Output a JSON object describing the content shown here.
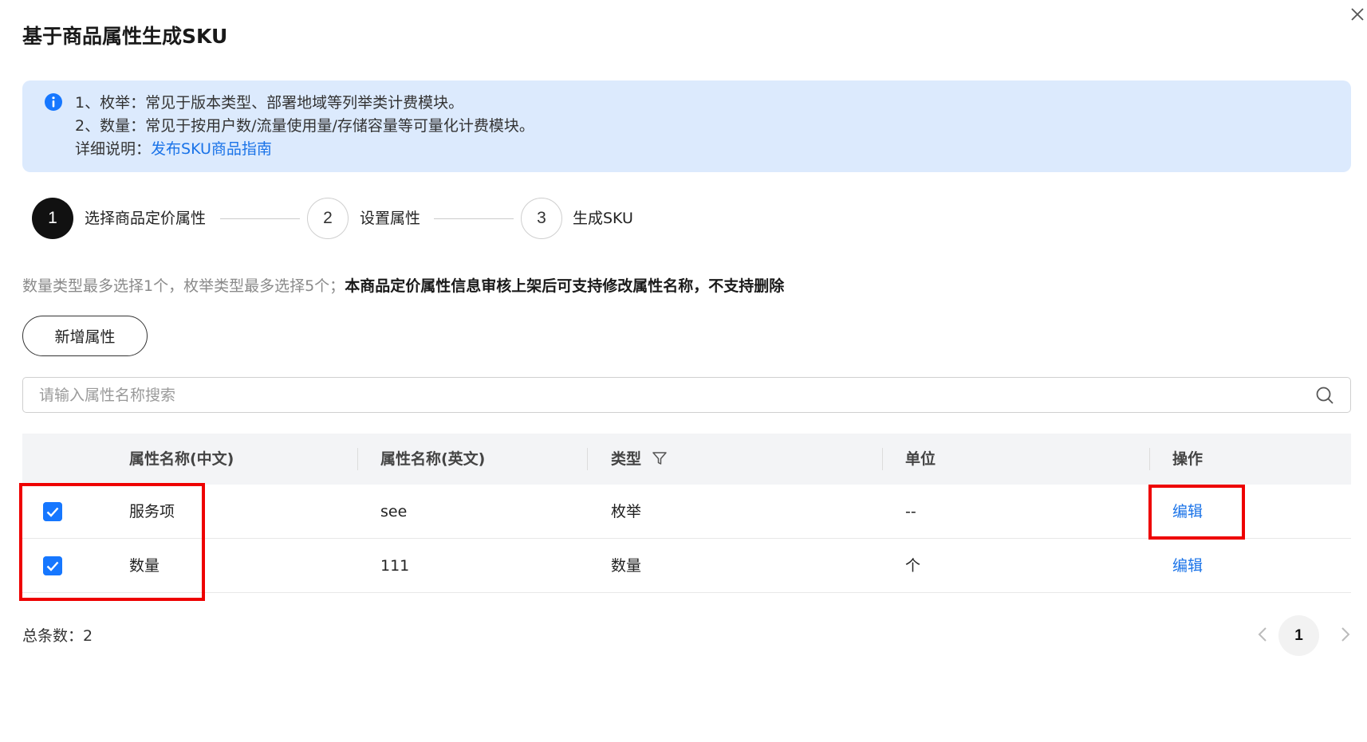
{
  "dialog": {
    "title": "基于商品属性生成SKU"
  },
  "info": {
    "line1": "1、枚举：常见于版本类型、部署地域等列举类计费模块。",
    "line2": "2、数量：常见于按用户数/流量使用量/存储容量等可量化计费模块。",
    "detail_prefix": "详细说明：",
    "detail_link": "发布SKU商品指南"
  },
  "steps": [
    {
      "number": "1",
      "label": "选择商品定价属性",
      "state": "active"
    },
    {
      "number": "2",
      "label": "设置属性",
      "state": "idle"
    },
    {
      "number": "3",
      "label": "生成SKU",
      "state": "idle"
    }
  ],
  "note": {
    "normal": "数量类型最多选择1个，枚举类型最多选择5个；",
    "bold": "本商品定价属性信息审核上架后可支持修改属性名称，不支持删除"
  },
  "add_button": "新增属性",
  "search": {
    "placeholder": "请输入属性名称搜索"
  },
  "table": {
    "headers": [
      "属性名称(中文)",
      "属性名称(英文)",
      "类型",
      "单位",
      "操作"
    ],
    "rows": [
      {
        "checked": true,
        "name_cn": "服务项",
        "name_en": "see",
        "type": "枚举",
        "unit": "--",
        "action": "编辑"
      },
      {
        "checked": true,
        "name_cn": "数量",
        "name_en": "111",
        "type": "数量",
        "unit": "个",
        "action": "编辑"
      }
    ]
  },
  "footer": {
    "total": "总条数：2",
    "current_page": "1"
  },
  "colors": {
    "accent": "#1a73e8",
    "checkbox": "#1677ff",
    "info_bg": "#dceafd",
    "highlight": "#ee0000"
  }
}
